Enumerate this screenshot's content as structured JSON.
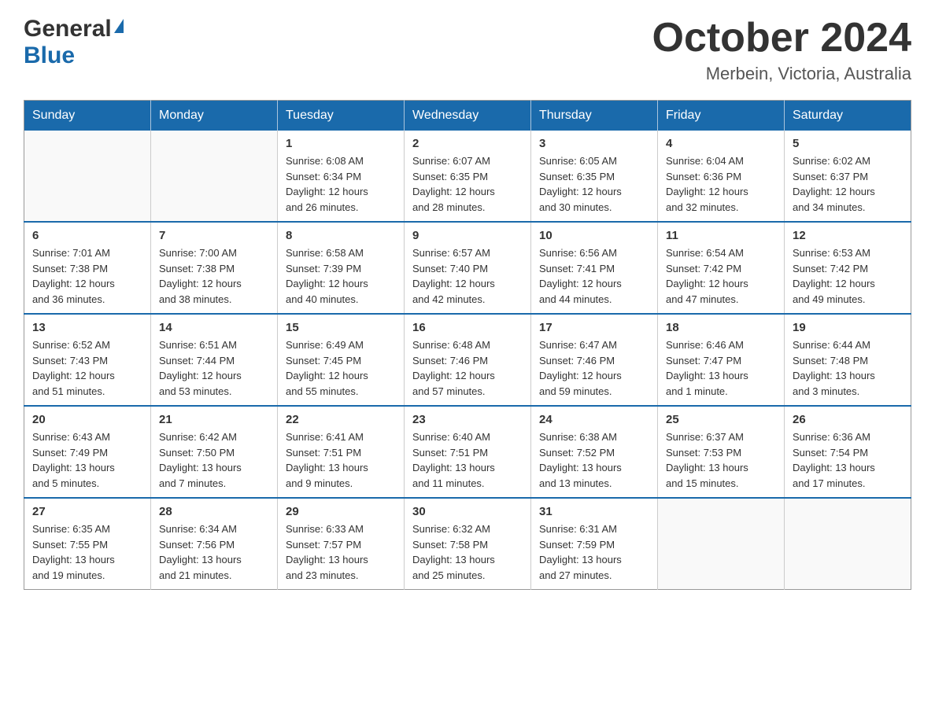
{
  "header": {
    "logo_general": "General",
    "logo_blue": "Blue",
    "month_title": "October 2024",
    "location": "Merbein, Victoria, Australia"
  },
  "weekdays": [
    "Sunday",
    "Monday",
    "Tuesday",
    "Wednesday",
    "Thursday",
    "Friday",
    "Saturday"
  ],
  "weeks": [
    [
      {
        "day": "",
        "info": ""
      },
      {
        "day": "",
        "info": ""
      },
      {
        "day": "1",
        "info": "Sunrise: 6:08 AM\nSunset: 6:34 PM\nDaylight: 12 hours\nand 26 minutes."
      },
      {
        "day": "2",
        "info": "Sunrise: 6:07 AM\nSunset: 6:35 PM\nDaylight: 12 hours\nand 28 minutes."
      },
      {
        "day": "3",
        "info": "Sunrise: 6:05 AM\nSunset: 6:35 PM\nDaylight: 12 hours\nand 30 minutes."
      },
      {
        "day": "4",
        "info": "Sunrise: 6:04 AM\nSunset: 6:36 PM\nDaylight: 12 hours\nand 32 minutes."
      },
      {
        "day": "5",
        "info": "Sunrise: 6:02 AM\nSunset: 6:37 PM\nDaylight: 12 hours\nand 34 minutes."
      }
    ],
    [
      {
        "day": "6",
        "info": "Sunrise: 7:01 AM\nSunset: 7:38 PM\nDaylight: 12 hours\nand 36 minutes."
      },
      {
        "day": "7",
        "info": "Sunrise: 7:00 AM\nSunset: 7:38 PM\nDaylight: 12 hours\nand 38 minutes."
      },
      {
        "day": "8",
        "info": "Sunrise: 6:58 AM\nSunset: 7:39 PM\nDaylight: 12 hours\nand 40 minutes."
      },
      {
        "day": "9",
        "info": "Sunrise: 6:57 AM\nSunset: 7:40 PM\nDaylight: 12 hours\nand 42 minutes."
      },
      {
        "day": "10",
        "info": "Sunrise: 6:56 AM\nSunset: 7:41 PM\nDaylight: 12 hours\nand 44 minutes."
      },
      {
        "day": "11",
        "info": "Sunrise: 6:54 AM\nSunset: 7:42 PM\nDaylight: 12 hours\nand 47 minutes."
      },
      {
        "day": "12",
        "info": "Sunrise: 6:53 AM\nSunset: 7:42 PM\nDaylight: 12 hours\nand 49 minutes."
      }
    ],
    [
      {
        "day": "13",
        "info": "Sunrise: 6:52 AM\nSunset: 7:43 PM\nDaylight: 12 hours\nand 51 minutes."
      },
      {
        "day": "14",
        "info": "Sunrise: 6:51 AM\nSunset: 7:44 PM\nDaylight: 12 hours\nand 53 minutes."
      },
      {
        "day": "15",
        "info": "Sunrise: 6:49 AM\nSunset: 7:45 PM\nDaylight: 12 hours\nand 55 minutes."
      },
      {
        "day": "16",
        "info": "Sunrise: 6:48 AM\nSunset: 7:46 PM\nDaylight: 12 hours\nand 57 minutes."
      },
      {
        "day": "17",
        "info": "Sunrise: 6:47 AM\nSunset: 7:46 PM\nDaylight: 12 hours\nand 59 minutes."
      },
      {
        "day": "18",
        "info": "Sunrise: 6:46 AM\nSunset: 7:47 PM\nDaylight: 13 hours\nand 1 minute."
      },
      {
        "day": "19",
        "info": "Sunrise: 6:44 AM\nSunset: 7:48 PM\nDaylight: 13 hours\nand 3 minutes."
      }
    ],
    [
      {
        "day": "20",
        "info": "Sunrise: 6:43 AM\nSunset: 7:49 PM\nDaylight: 13 hours\nand 5 minutes."
      },
      {
        "day": "21",
        "info": "Sunrise: 6:42 AM\nSunset: 7:50 PM\nDaylight: 13 hours\nand 7 minutes."
      },
      {
        "day": "22",
        "info": "Sunrise: 6:41 AM\nSunset: 7:51 PM\nDaylight: 13 hours\nand 9 minutes."
      },
      {
        "day": "23",
        "info": "Sunrise: 6:40 AM\nSunset: 7:51 PM\nDaylight: 13 hours\nand 11 minutes."
      },
      {
        "day": "24",
        "info": "Sunrise: 6:38 AM\nSunset: 7:52 PM\nDaylight: 13 hours\nand 13 minutes."
      },
      {
        "day": "25",
        "info": "Sunrise: 6:37 AM\nSunset: 7:53 PM\nDaylight: 13 hours\nand 15 minutes."
      },
      {
        "day": "26",
        "info": "Sunrise: 6:36 AM\nSunset: 7:54 PM\nDaylight: 13 hours\nand 17 minutes."
      }
    ],
    [
      {
        "day": "27",
        "info": "Sunrise: 6:35 AM\nSunset: 7:55 PM\nDaylight: 13 hours\nand 19 minutes."
      },
      {
        "day": "28",
        "info": "Sunrise: 6:34 AM\nSunset: 7:56 PM\nDaylight: 13 hours\nand 21 minutes."
      },
      {
        "day": "29",
        "info": "Sunrise: 6:33 AM\nSunset: 7:57 PM\nDaylight: 13 hours\nand 23 minutes."
      },
      {
        "day": "30",
        "info": "Sunrise: 6:32 AM\nSunset: 7:58 PM\nDaylight: 13 hours\nand 25 minutes."
      },
      {
        "day": "31",
        "info": "Sunrise: 6:31 AM\nSunset: 7:59 PM\nDaylight: 13 hours\nand 27 minutes."
      },
      {
        "day": "",
        "info": ""
      },
      {
        "day": "",
        "info": ""
      }
    ]
  ]
}
